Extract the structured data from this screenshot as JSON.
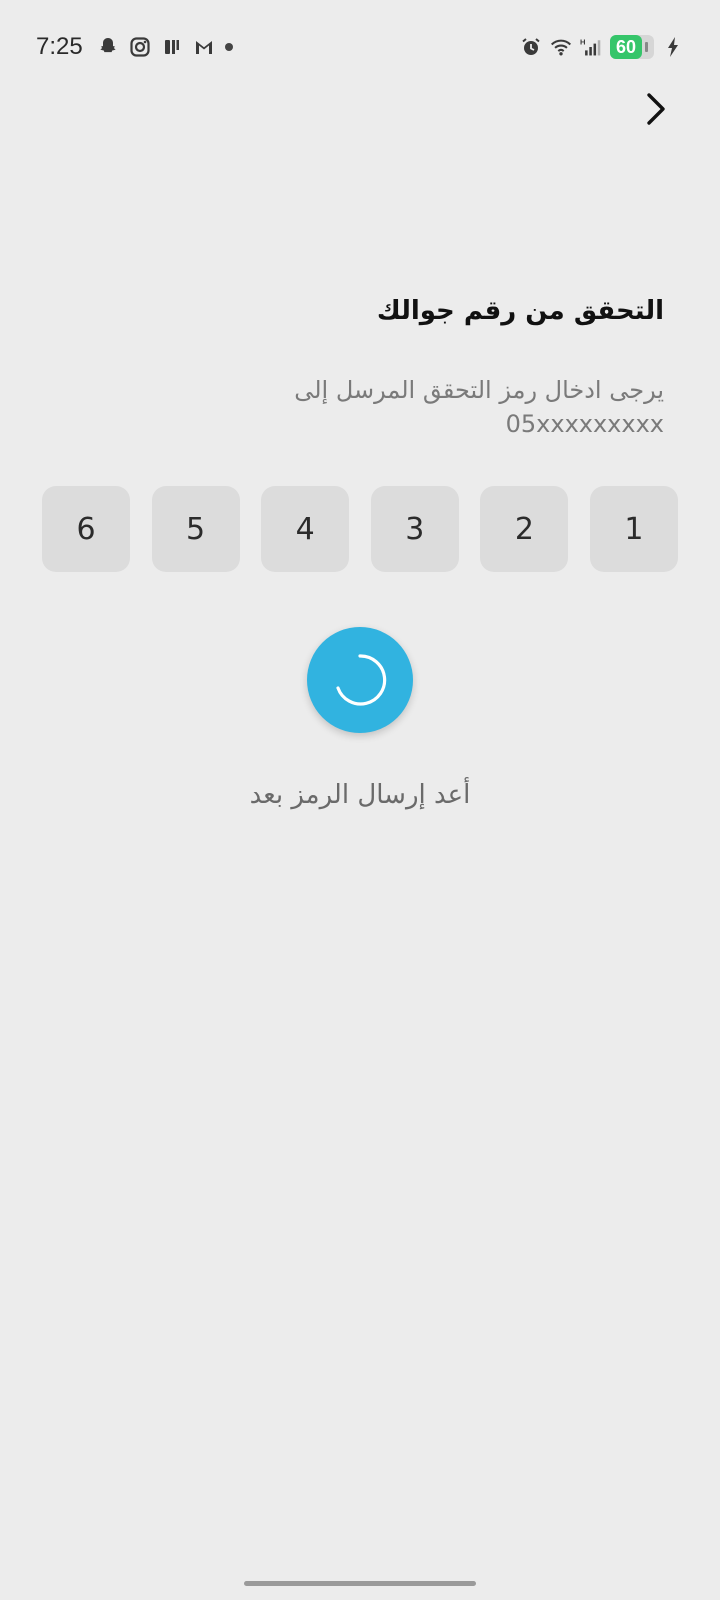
{
  "status_bar": {
    "time": "7:25",
    "battery_level": "60",
    "icons_left": [
      "snapchat-icon",
      "instagram-icon",
      "nfc-icon",
      "gmail-icon",
      "dot-icon"
    ],
    "icons_right": [
      "alarm-icon",
      "wifi-icon",
      "signal-icon",
      "battery-icon",
      "charging-icon"
    ]
  },
  "header": {
    "back_icon": "chevron-right-icon"
  },
  "main": {
    "title": "التحقق من رقم جوالك",
    "subtitle": "يرجى ادخال رمز التحقق المرسل إلى",
    "phone": "05xxxxxxxxx",
    "otp_digits": [
      "1",
      "2",
      "3",
      "4",
      "5",
      "6"
    ],
    "resend_text": "أعد إرسال الرمز بعد"
  },
  "colors": {
    "background": "#ececec",
    "accent": "#31b3e0",
    "otp_box": "#dcdcdc",
    "battery": "#35c56a"
  }
}
